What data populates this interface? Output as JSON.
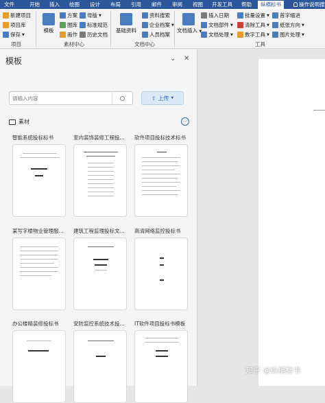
{
  "tabs": [
    "文件",
    "开始",
    "插入",
    "绘图",
    "设计",
    "布局",
    "引用",
    "邮件",
    "审阅",
    "视图",
    "开发工具",
    "帮助",
    "纵横标书"
  ],
  "active_tab": "纵横标书",
  "tell_me": "操作说明搜",
  "ribbon": {
    "project": {
      "new_project": "新建项目",
      "project_lib": "项目库",
      "save": "保存",
      "label": "项目"
    },
    "material": {
      "template": "模板",
      "plan": "方案",
      "master": "母版",
      "gallery": "图库",
      "standard": "标准规范",
      "drawing": "画作",
      "history": "历史文档",
      "label": "素材中心"
    },
    "doc_center": {
      "basic_info": "基础资料",
      "resource_search": "资料搜索",
      "enterprise": "企业档案",
      "personnel": "人员档案",
      "label": "文档中心"
    },
    "tools": {
      "doc_insert": "文档插入",
      "insert_date": "插入日期",
      "doc_component": "文档部件",
      "doc_process": "文档处理",
      "batch_setting": "批量设置",
      "clear_tools": "清除工具",
      "number_tools": "数字工具",
      "indent": "首字缩进",
      "paper_dir": "纸张方向",
      "image_process": "图片处理",
      "label": "工具"
    }
  },
  "pane": {
    "title": "模板",
    "search_placeholder": "请输入内容",
    "upload_label": "上传",
    "folder_label": "素材",
    "cards": [
      {
        "title": "智能系统投标标书"
      },
      {
        "title": "室内装饰装修工程投..."
      },
      {
        "title": "软件项目投标技术标书"
      },
      {
        "title": "某写字楼物业管理服..."
      },
      {
        "title": "建筑工程监理投标文..."
      },
      {
        "title": "高清网络监控投标书"
      },
      {
        "title": "办公楼精装修投标书"
      },
      {
        "title": "安防监控系统技术投..."
      },
      {
        "title": "IT软件项目投标书模板"
      }
    ]
  },
  "watermark": "知乎 @纵横标书",
  "colors": {
    "ribbon_tab": "#2b579a",
    "upload_bg": "#dbe9f7",
    "accent": "#2a6ab5"
  }
}
